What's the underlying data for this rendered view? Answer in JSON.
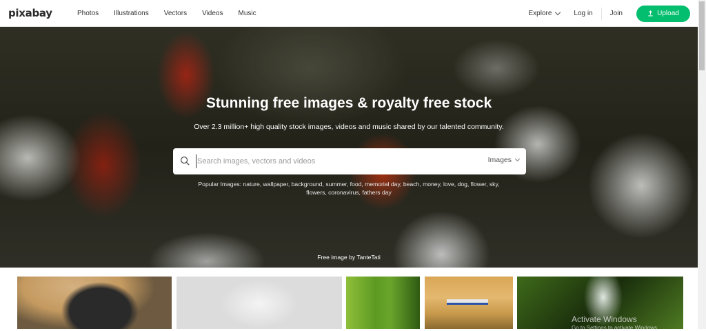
{
  "nav": {
    "logo": "pixabay",
    "links": [
      "Photos",
      "Illustrations",
      "Vectors",
      "Videos",
      "Music"
    ],
    "explore": "Explore",
    "login": "Log in",
    "join": "Join",
    "upload": "Upload"
  },
  "hero": {
    "title": "Stunning free images & royalty free stock",
    "subtitle": "Over 2.3 million+ high quality stock images, videos and music shared by our talented community.",
    "search_placeholder": "Search images, vectors and videos",
    "search_type": "Images",
    "popular_line1": "Popular Images: nature, wallpaper, background, summer, food, memorial day, beach, money, love, dog, flower, sky,",
    "popular_line2": "flowers, coronavirus, fathers day",
    "credit": "Free image by TanteTati"
  },
  "overlay": {
    "activate": "Activate Windows",
    "activate_sub": "Go to Settings to activate Windows."
  },
  "colors": {
    "accent": "#02be6e"
  },
  "icons": {
    "search": "search-icon",
    "upload": "upload-icon",
    "chevron": "chevron-down-icon"
  }
}
